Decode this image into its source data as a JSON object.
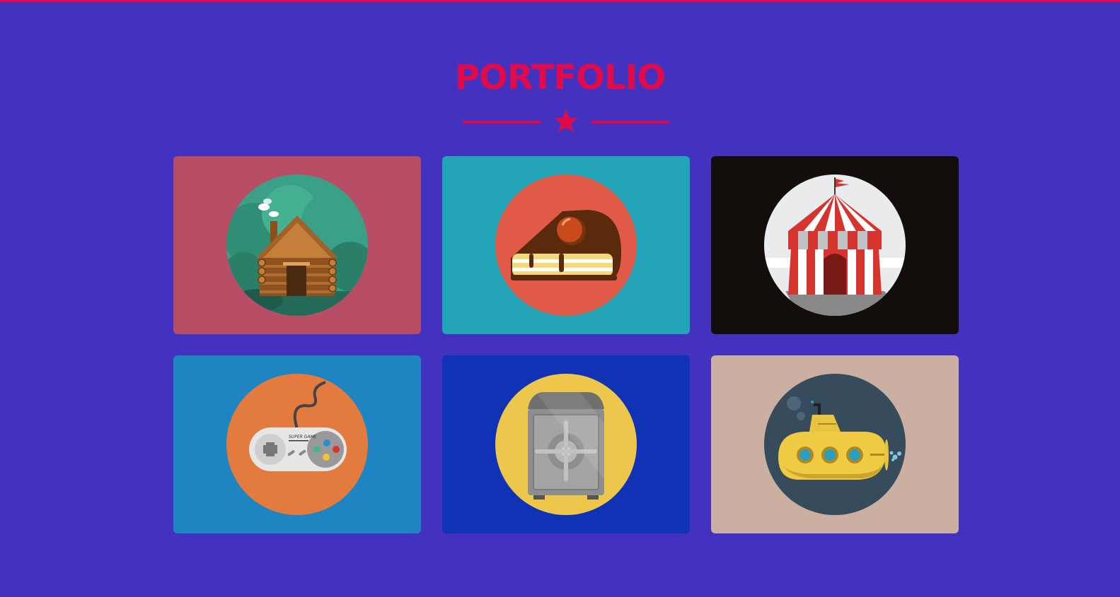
{
  "page": {
    "title": "PORTFOLIO",
    "background_color": "#4232bf",
    "accent_color": "#e10a4b"
  },
  "divider": {
    "icon": "star-icon"
  },
  "portfolio": {
    "items": [
      {
        "icon": "log-cabin-icon",
        "card_color": "#b74e66",
        "circle_color": "#3aa088"
      },
      {
        "icon": "cake-slice-icon",
        "card_color": "#22a3b6",
        "circle_color": "#e05a47"
      },
      {
        "icon": "circus-tent-icon",
        "card_color": "#130d0c",
        "circle_color": "#e9ebec"
      },
      {
        "icon": "game-controller-icon",
        "card_color": "#1f84c2",
        "circle_color": "#e27b3d"
      },
      {
        "icon": "safe-icon",
        "card_color": "#1033b5",
        "circle_color": "#ecc74c"
      },
      {
        "icon": "submarine-icon",
        "card_color": "#cbb0a1",
        "circle_color": "#364b5c"
      }
    ],
    "controller_label": "SUPER GAME"
  }
}
